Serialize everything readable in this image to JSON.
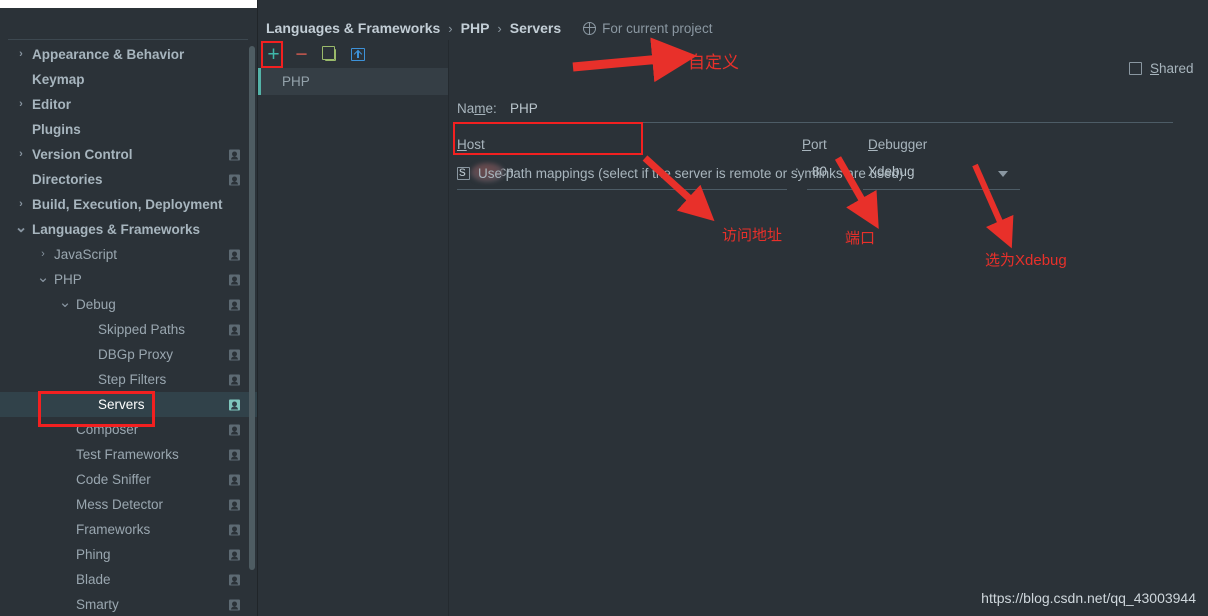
{
  "sidebar": {
    "items": [
      {
        "label": "Appearance & Behavior",
        "indent": 0,
        "caret": "chevron-right",
        "bold": true,
        "badge": false,
        "selected": false
      },
      {
        "label": "Keymap",
        "indent": 0,
        "caret": "",
        "bold": true,
        "badge": false,
        "selected": false
      },
      {
        "label": "Editor",
        "indent": 0,
        "caret": "chevron-right",
        "bold": true,
        "badge": false,
        "selected": false
      },
      {
        "label": "Plugins",
        "indent": 0,
        "caret": "",
        "bold": true,
        "badge": false,
        "selected": false
      },
      {
        "label": "Version Control",
        "indent": 0,
        "caret": "chevron-right",
        "bold": true,
        "badge": true,
        "selected": false
      },
      {
        "label": "Directories",
        "indent": 0,
        "caret": "",
        "bold": true,
        "badge": true,
        "selected": false
      },
      {
        "label": "Build, Execution, Deployment",
        "indent": 0,
        "caret": "chevron-right",
        "bold": true,
        "badge": false,
        "selected": false
      },
      {
        "label": "Languages & Frameworks",
        "indent": 0,
        "caret": "chevron-down",
        "bold": true,
        "badge": false,
        "selected": false
      },
      {
        "label": "JavaScript",
        "indent": 1,
        "caret": "chevron-right",
        "bold": false,
        "badge": true,
        "selected": false
      },
      {
        "label": "PHP",
        "indent": 1,
        "caret": "chevron-down",
        "bold": false,
        "badge": true,
        "selected": false
      },
      {
        "label": "Debug",
        "indent": 2,
        "caret": "chevron-down",
        "bold": false,
        "badge": true,
        "selected": false
      },
      {
        "label": "Skipped Paths",
        "indent": 3,
        "caret": "",
        "bold": false,
        "badge": true,
        "selected": false
      },
      {
        "label": "DBGp Proxy",
        "indent": 3,
        "caret": "",
        "bold": false,
        "badge": true,
        "selected": false
      },
      {
        "label": "Step Filters",
        "indent": 3,
        "caret": "",
        "bold": false,
        "badge": true,
        "selected": false
      },
      {
        "label": "Servers",
        "indent": 3,
        "caret": "",
        "bold": false,
        "badge": true,
        "selected": true
      },
      {
        "label": "Composer",
        "indent": 2,
        "caret": "",
        "bold": false,
        "badge": true,
        "selected": false
      },
      {
        "label": "Test Frameworks",
        "indent": 2,
        "caret": "",
        "bold": false,
        "badge": true,
        "selected": false
      },
      {
        "label": "Code Sniffer",
        "indent": 2,
        "caret": "",
        "bold": false,
        "badge": true,
        "selected": false
      },
      {
        "label": "Mess Detector",
        "indent": 2,
        "caret": "",
        "bold": false,
        "badge": true,
        "selected": false
      },
      {
        "label": "Frameworks",
        "indent": 2,
        "caret": "",
        "bold": false,
        "badge": true,
        "selected": false
      },
      {
        "label": "Phing",
        "indent": 2,
        "caret": "",
        "bold": false,
        "badge": true,
        "selected": false
      },
      {
        "label": "Blade",
        "indent": 2,
        "caret": "",
        "bold": false,
        "badge": true,
        "selected": false
      },
      {
        "label": "Smarty",
        "indent": 2,
        "caret": "",
        "bold": false,
        "badge": true,
        "selected": false
      }
    ]
  },
  "breadcrumb": {
    "crumbs": [
      "Languages & Frameworks",
      "PHP",
      "Servers"
    ],
    "separator": "›",
    "scope_icon": "globe-icon",
    "scope_text": "For current project"
  },
  "toolbar": {
    "add_label": "+",
    "add_icon": "plus-icon",
    "remove_label": "−",
    "remove_icon": "minus-icon",
    "copy_icon": "copy-icon",
    "share_icon": "import-export-icon"
  },
  "server_list": {
    "items": [
      {
        "label": "PHP",
        "selected": true
      }
    ]
  },
  "detail": {
    "name_label": "Na",
    "name_label_mnemonic": "m",
    "name_label_tail": "e:",
    "name_value": "PHP",
    "shared_label_mnemonic": "S",
    "shared_label_tail": "hared",
    "shared_checked": false,
    "host_label_mnemonic": "H",
    "host_label_tail": "ost",
    "host_value": "s",
    "host_value_tail": "cn",
    "host_redaction": "blurred-redaction",
    "colon": ":",
    "port_label_mnemonic": "P",
    "port_label_tail": "ort",
    "port_value": "80",
    "debugger_label_mnemonic": "D",
    "debugger_label_tail": "ebugger",
    "debugger_value": "Xdebug",
    "debugger_caret_icon": "chevron-down-icon",
    "pathmap_label": "Use path mappings (select if the server is remote or symlinks are used)",
    "pathmap_checked": false
  },
  "annotations": {
    "custom": "自定义",
    "address": "访问地址",
    "port": "端口",
    "xdebug": "选为Xdebug",
    "accent_color": "#e8302a"
  },
  "watermark": {
    "url": "https://blog.csdn.net/qq_43003944"
  }
}
